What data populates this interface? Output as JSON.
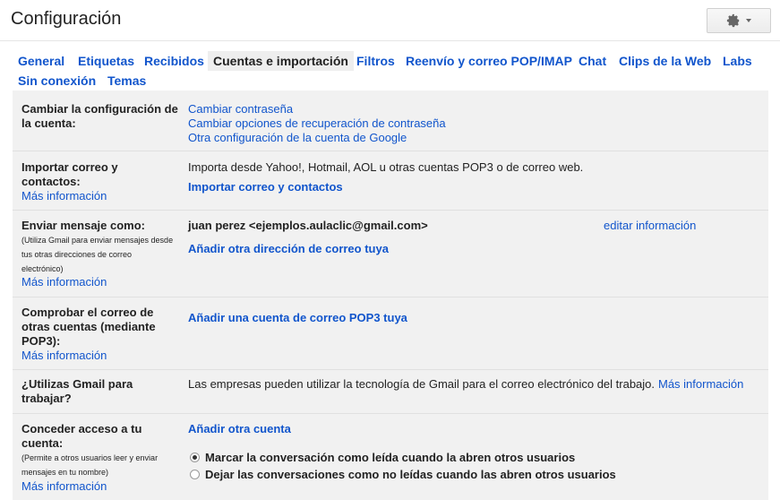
{
  "header": {
    "title": "Configuración"
  },
  "tabs": [
    {
      "label": "General"
    },
    {
      "label": "Etiquetas"
    },
    {
      "label": "Recibidos"
    },
    {
      "label": "Cuentas e importación"
    },
    {
      "label": "Filtros"
    },
    {
      "label": "Reenvío y correo POP/IMAP"
    },
    {
      "label": "Chat"
    },
    {
      "label": "Clips de la Web"
    },
    {
      "label": "Labs"
    },
    {
      "label": "Sin conexión"
    },
    {
      "label": "Temas"
    }
  ],
  "sections": {
    "cambiar": {
      "label": "Cambiar la configuración de la cuenta:",
      "links": [
        "Cambiar contraseña",
        "Cambiar opciones de recuperación de contraseña",
        "Otra configuración de la cuenta de Google"
      ]
    },
    "importar": {
      "label": "Importar correo y contactos:",
      "more": "Más información",
      "text": "Importa desde Yahoo!, Hotmail, AOL u otras cuentas POP3 o de correo web.",
      "action": "Importar correo y contactos"
    },
    "enviar": {
      "label": "Enviar mensaje como:",
      "help": "(Utiliza Gmail para enviar mensajes desde tus otras direcciones de correo electrónico)",
      "more": "Más información",
      "address": "juan perez <ejemplos.aulaclic@gmail.com>",
      "edit": "editar información",
      "action": "Añadir otra dirección de correo tuya"
    },
    "comprobar": {
      "label": "Comprobar el correo de otras cuentas (mediante POP3):",
      "more": "Más información",
      "action": "Añadir una cuenta de correo POP3 tuya"
    },
    "trabajo": {
      "label": "¿Utilizas Gmail para trabajar?",
      "text": "Las empresas pueden utilizar la tecnología de Gmail para el correo electrónico del trabajo.",
      "more": "Más información"
    },
    "acceso": {
      "label": "Conceder acceso a tu cuenta:",
      "help": "(Permite a otros usuarios leer y enviar mensajes en tu nombre)",
      "more": "Más información",
      "action": "Añadir otra cuenta",
      "options": [
        {
          "label": "Marcar la conversación como leída cuando la abren otros usuarios",
          "selected": true
        },
        {
          "label": "Dejar las conversaciones como no leídas cuando las abren otros usuarios",
          "selected": false
        }
      ]
    }
  }
}
